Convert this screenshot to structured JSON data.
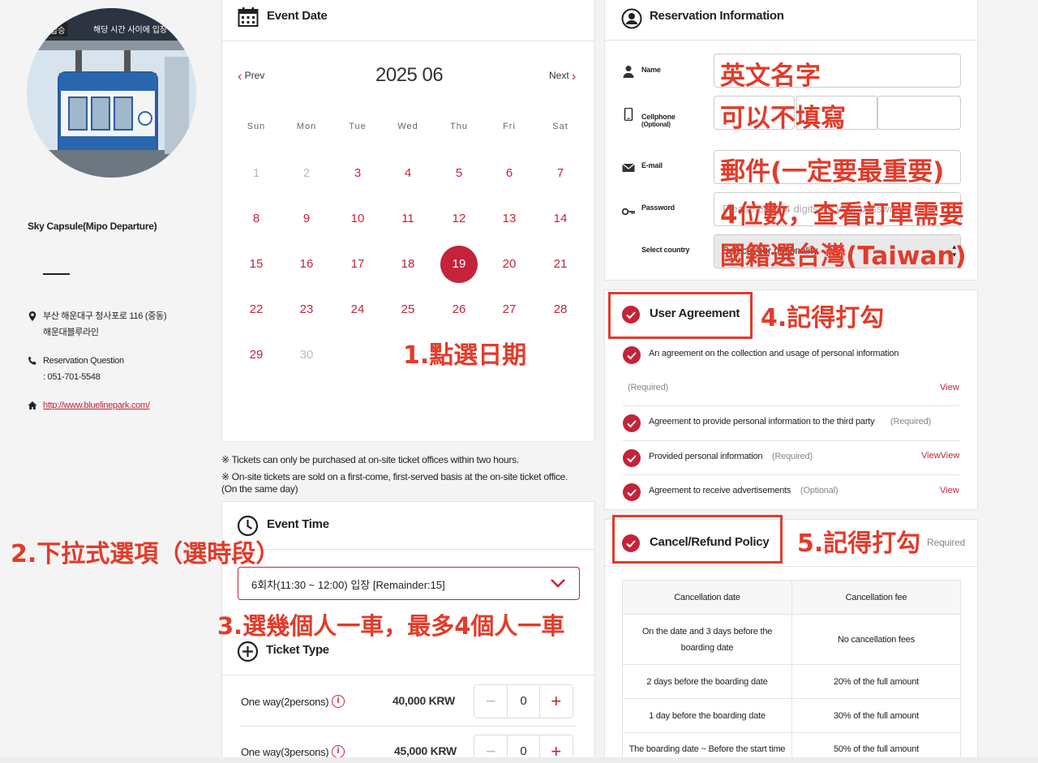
{
  "venue": {
    "photo_banner": "해당 시간 사이에 입장 가",
    "photo_banner_left": "탑승",
    "title": "Sky Capsule(Mipo Departure)",
    "address_line1": "부산 해운대구 청사포로 116 (중동)",
    "address_line2": "해운대블루라인",
    "question_label": "Reservation Question",
    "phone": ": 051-701-5548",
    "website": "http://www.bluelinepark.com/"
  },
  "event_date": {
    "header": "Event Date",
    "month_title": "2025 06",
    "prev": "Prev",
    "next": "Next",
    "weekdays": [
      "Sun",
      "Mon",
      "Tue",
      "Wed",
      "Thu",
      "Fri",
      "Sat"
    ],
    "weeks": [
      [
        {
          "d": "1",
          "s": "dis"
        },
        {
          "d": "2",
          "s": "dis"
        },
        {
          "d": "3",
          "s": ""
        },
        {
          "d": "4",
          "s": ""
        },
        {
          "d": "5",
          "s": ""
        },
        {
          "d": "6",
          "s": ""
        },
        {
          "d": "7",
          "s": ""
        }
      ],
      [
        {
          "d": "8",
          "s": ""
        },
        {
          "d": "9",
          "s": ""
        },
        {
          "d": "10",
          "s": ""
        },
        {
          "d": "11",
          "s": ""
        },
        {
          "d": "12",
          "s": ""
        },
        {
          "d": "13",
          "s": ""
        },
        {
          "d": "14",
          "s": ""
        }
      ],
      [
        {
          "d": "15",
          "s": ""
        },
        {
          "d": "16",
          "s": ""
        },
        {
          "d": "17",
          "s": ""
        },
        {
          "d": "18",
          "s": ""
        },
        {
          "d": "19",
          "s": "sel"
        },
        {
          "d": "20",
          "s": ""
        },
        {
          "d": "21",
          "s": ""
        }
      ],
      [
        {
          "d": "22",
          "s": ""
        },
        {
          "d": "23",
          "s": ""
        },
        {
          "d": "24",
          "s": ""
        },
        {
          "d": "25",
          "s": ""
        },
        {
          "d": "26",
          "s": ""
        },
        {
          "d": "27",
          "s": ""
        },
        {
          "d": "28",
          "s": ""
        }
      ],
      [
        {
          "d": "29",
          "s": ""
        },
        {
          "d": "30",
          "s": "dis"
        }
      ]
    ]
  },
  "notes": {
    "note1": "※ Tickets can only be purchased at on-site ticket offices within two hours.",
    "note2": "※ On-site tickets are sold on a first-come, first-served basis at the on-site ticket office.",
    "note3": "(On the same day)"
  },
  "event_time": {
    "header": "Event Time",
    "selected": "6회차(11:30 ~ 12:00) 입장 [Remainder:15]"
  },
  "ticket_type": {
    "header": "Ticket Type",
    "rows": [
      {
        "label": "One way(2persons)",
        "price": "40,000 KRW",
        "qty": "0"
      },
      {
        "label": "One way(3persons)",
        "price": "45,000 KRW",
        "qty": "0"
      }
    ]
  },
  "reservation": {
    "header": "Reservation Information",
    "name_label": "Name",
    "cellphone_label": "Cellphone",
    "cellphone_sub": "(Optional)",
    "email_label": "E-mail",
    "password_label": "Password",
    "password_placeholder": "Please enter 4 digits for your password",
    "country_label": "Select country",
    "country_value": "Select your nationality"
  },
  "user_agreement": {
    "header": "User Agreement",
    "item1": "An agreement on the collection and usage of personal information",
    "item1_req": "(Required)",
    "item2": "Agreement to provide personal information to the third party",
    "item2_req": "(Required)",
    "item3": "Provided personal information",
    "item3_req": "(Required)",
    "item4": "Agreement to receive advertisements",
    "item4_req": "(Optional)",
    "view": "View",
    "view_double": "ViewView"
  },
  "refund": {
    "header": "Cancel/Refund Policy",
    "required": "Required",
    "col_date": "Cancellation date",
    "col_fee": "Cancellation fee",
    "rows": [
      {
        "date": "On the date and 3 days before the boarding date",
        "fee": "No cancellation fees"
      },
      {
        "date": "2 days before the boarding date",
        "fee": "20% of the full amount"
      },
      {
        "date": "1 day before the boarding date",
        "fee": "30% of the full amount"
      },
      {
        "date": "The boarding date ~ Before the start time",
        "fee": "50% of the full amount"
      }
    ]
  },
  "annotations": {
    "step1": "1.點選日期",
    "step2": "2.下拉式選項（選時段）",
    "step3": "3.選幾個人一車，最多4個人一車",
    "step4": "4.記得打勾",
    "step5": "5.記得打勾",
    "name_hint": "英文名字",
    "phone_hint": "可以不填寫",
    "email_hint": "郵件(一定要最重要)",
    "password_hint": "4位數，查看訂單需要",
    "country_hint": "國籍選台灣(Taiwan)"
  },
  "colors": {
    "accent": "#c4233a",
    "annotation": "#e23b2a"
  }
}
